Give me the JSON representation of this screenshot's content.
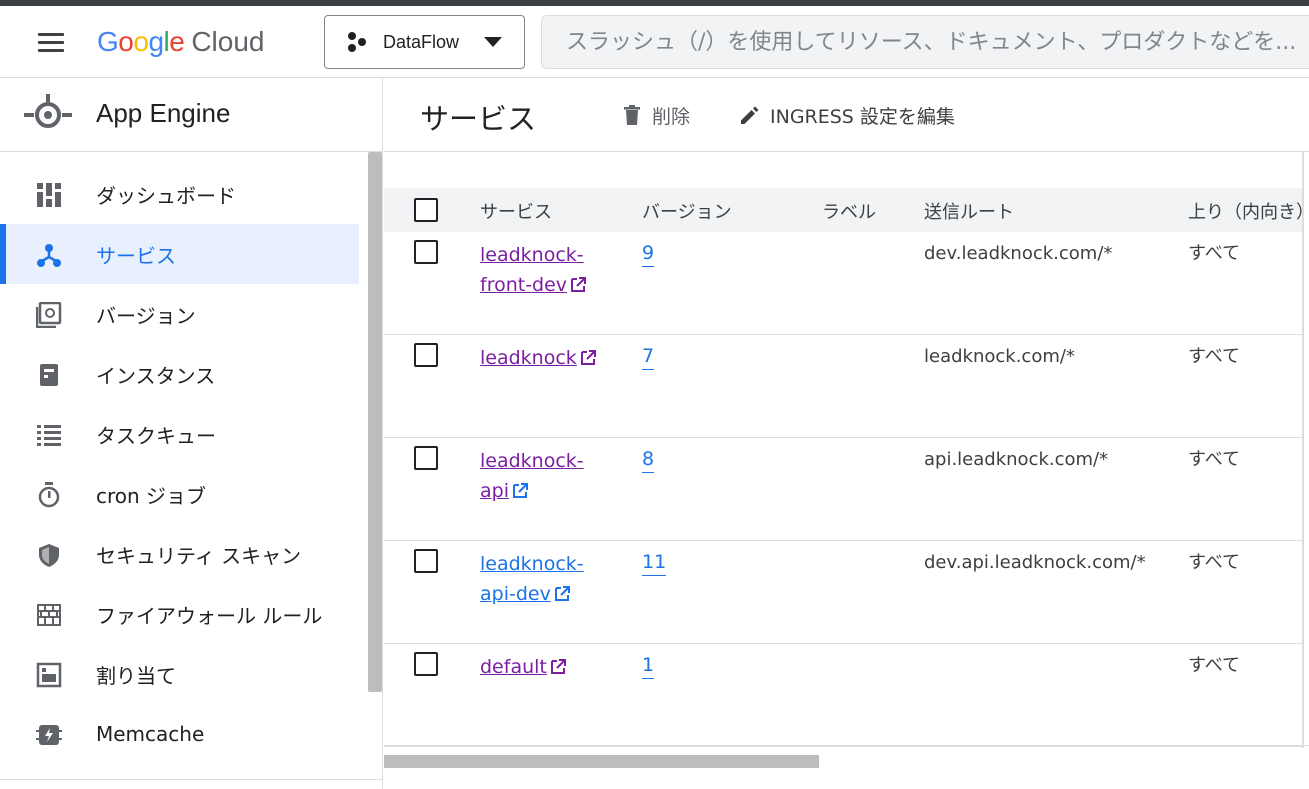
{
  "header": {
    "logo_google": [
      "G",
      "o",
      "o",
      "g",
      "l",
      "e"
    ],
    "logo_cloud": "Cloud",
    "project": "DataFlow",
    "search_placeholder": "スラッシュ（/）を使用してリソース、ドキュメント、プロダクトなどを..."
  },
  "brand_colors": {
    "blue": "#4285F4",
    "red": "#EA4335",
    "yellow": "#FBBC05",
    "green": "#34A853",
    "accent": "#1a73e8",
    "visited_link": "#7b1fa2"
  },
  "sidebar": {
    "product_title": "App Engine",
    "items": [
      {
        "label": "ダッシュボード",
        "icon": "dashboard-icon",
        "active": false
      },
      {
        "label": "サービス",
        "icon": "services-icon",
        "active": true
      },
      {
        "label": "バージョン",
        "icon": "versions-icon",
        "active": false
      },
      {
        "label": "インスタンス",
        "icon": "instances-icon",
        "active": false
      },
      {
        "label": "タスクキュー",
        "icon": "task-queue-icon",
        "active": false
      },
      {
        "label": "cron ジョブ",
        "icon": "timer-icon",
        "active": false
      },
      {
        "label": "セキュリティ スキャン",
        "icon": "shield-icon",
        "active": false
      },
      {
        "label": "ファイアウォール ルール",
        "icon": "firewall-icon",
        "active": false
      },
      {
        "label": "割り当て",
        "icon": "quota-icon",
        "active": false
      },
      {
        "label": "Memcache",
        "icon": "memcache-icon",
        "active": false
      }
    ]
  },
  "main": {
    "title": "サービス",
    "toolbar": {
      "delete_label": "削除",
      "edit_ingress_label": "INGRESS 設定を編集"
    },
    "table": {
      "columns": [
        "サービス",
        "バージョン",
        "ラベル",
        "送信ルート",
        "上り（内向き）"
      ],
      "rows": [
        {
          "service_line1": "leadknock-",
          "service_line2": "front-dev",
          "versions": "9",
          "label": "",
          "route": "dev.leadknock.com/*",
          "ingress": "すべて"
        },
        {
          "service_line1": "leadknock",
          "service_line2": "",
          "versions": "7",
          "label": "",
          "route": "leadknock.com/*",
          "ingress": "すべて"
        },
        {
          "service_line1": "leadknock-",
          "service_line2": "api",
          "versions": "8",
          "label": "",
          "route": "api.leadknock.com/*",
          "ingress": "すべて"
        },
        {
          "service_line1": "leadknock-",
          "service_line2": "api-dev",
          "versions": "11",
          "label": "",
          "route": "dev.api.leadknock.com/*",
          "ingress": "すべて"
        },
        {
          "service_line1": "default",
          "service_line2": "",
          "versions": "1",
          "label": "",
          "route": "",
          "ingress": "すべて"
        }
      ]
    }
  }
}
